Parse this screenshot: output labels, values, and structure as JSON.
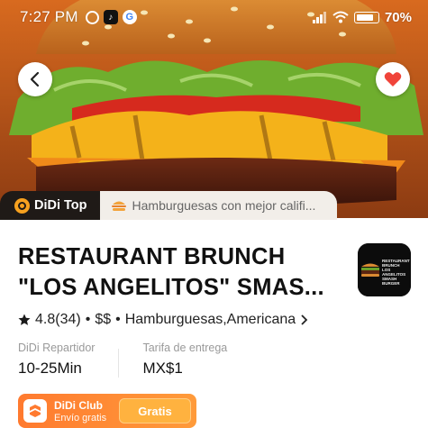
{
  "status_bar": {
    "time": "7:27 PM",
    "battery": "70"
  },
  "hero": {
    "description_icon": "burger-photo"
  },
  "tags": {
    "didi_top": "DiDi Top",
    "ranking": "Hamburguesas con mejor califi..."
  },
  "store": {
    "name": "RESTAURANT BRUNCH \"LOS ANGELITOS\" SMAS...",
    "logo_text": "RESTAURANT BRUNCH LOS ANGELITOS SMASH BURGER",
    "rating": "4.8",
    "rating_count": "(34)",
    "price": "$$",
    "separator": "•",
    "categories": "Hamburguesas,Americana"
  },
  "delivery": {
    "courier_label": "DiDi Repartidor",
    "courier_value": "10-25Min",
    "fee_label": "Tarifa de entrega",
    "fee_value": "MX$1"
  },
  "club": {
    "title": "DiDi Club",
    "subtitle": "Envío gratis",
    "button": "Gratis"
  },
  "colors": {
    "accent_orange": "#ff7a2f",
    "heart_red": "#f0443a",
    "didi_top_bg": "#1f1a17"
  }
}
